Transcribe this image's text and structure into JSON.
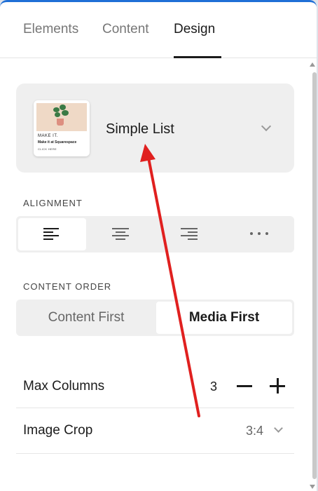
{
  "tabs": [
    {
      "label": "Elements"
    },
    {
      "label": "Content"
    },
    {
      "label": "Design"
    }
  ],
  "active_tab": "Design",
  "layout": {
    "name": "Simple List",
    "thumbnail": {
      "line1": "MAKE IT.",
      "line2": "Make it at Squarespace",
      "line3": "CLICK HERE"
    }
  },
  "alignment": {
    "label": "ALIGNMENT",
    "options": [
      "align-left-icon",
      "align-center-icon",
      "align-right-icon",
      "more-icon"
    ],
    "selected": "align-left-icon"
  },
  "content_order": {
    "label": "CONTENT ORDER",
    "options": [
      "Content First",
      "Media First"
    ],
    "selected": "Media First"
  },
  "max_columns": {
    "label": "Max Columns",
    "value": "3"
  },
  "image_crop": {
    "label": "Image Crop",
    "value": "3:4"
  },
  "annotation": {
    "color": "#e0201f"
  }
}
